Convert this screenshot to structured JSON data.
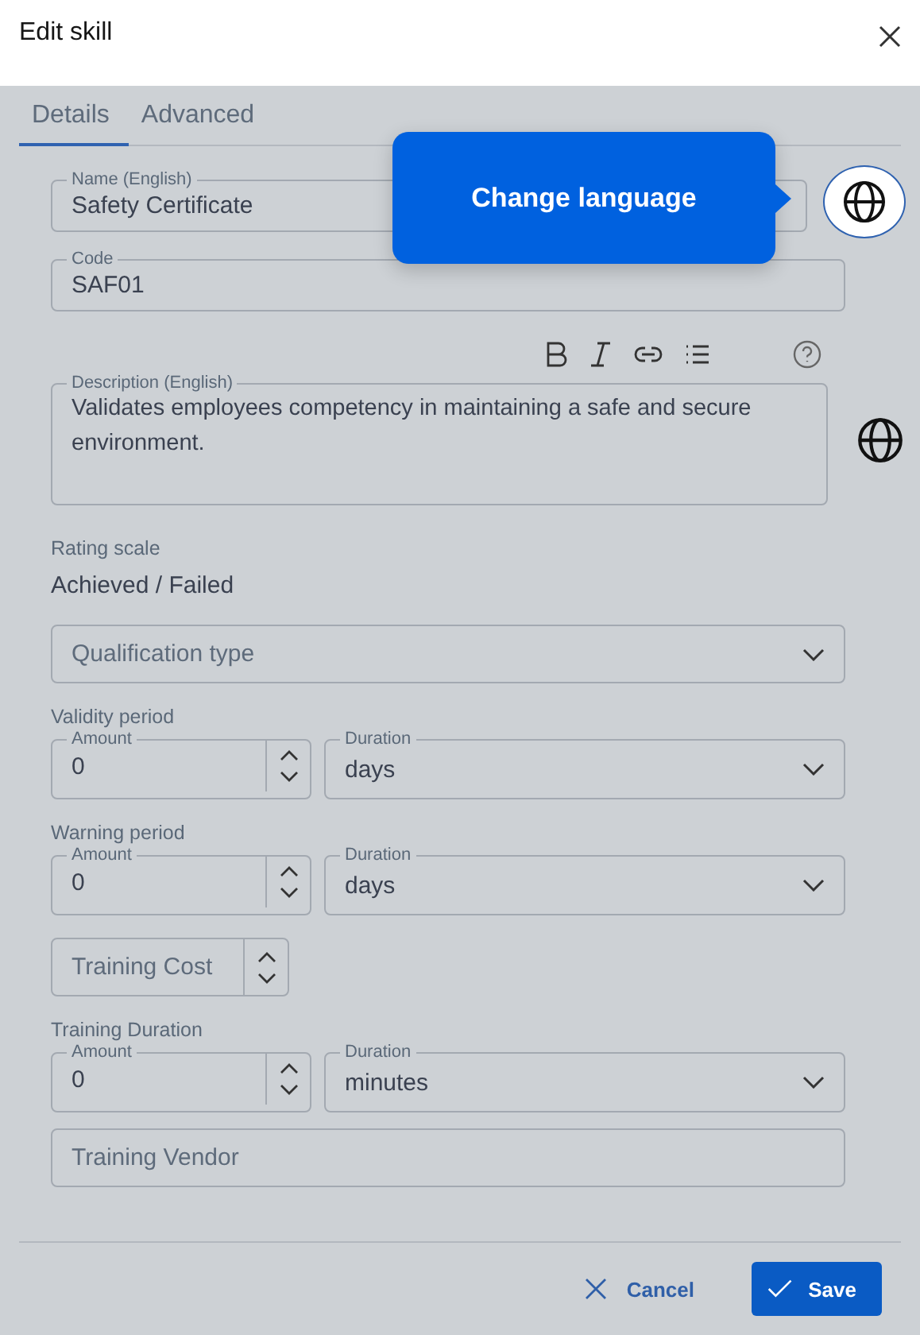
{
  "window": {
    "title": "Edit skill"
  },
  "tabs": [
    {
      "label": "Details",
      "selected": true
    },
    {
      "label": "Advanced",
      "selected": false
    }
  ],
  "name_field": {
    "label": "Name (English)",
    "value": "Safety Certificate"
  },
  "language_tooltip": {
    "text": "Change language"
  },
  "code_field": {
    "label": "Code",
    "value": "SAF01"
  },
  "description_field": {
    "label": "Description (English)",
    "value": "Validates employees competency in maintaining a safe and secure environment."
  },
  "rating_scale": {
    "label": "Rating scale",
    "value": "Achieved / Failed"
  },
  "qualification_type": {
    "placeholder": "Qualification type"
  },
  "fields": [
    {
      "kind": "period",
      "title": "Validity period",
      "amount": {
        "label": "Amount",
        "value": "0"
      },
      "duration": {
        "label": "Duration",
        "value": "days"
      }
    },
    {
      "kind": "period",
      "title": "Warning period",
      "amount": {
        "label": "Amount",
        "value": "0"
      },
      "duration": {
        "label": "Duration",
        "value": "days"
      }
    },
    {
      "kind": "number",
      "placeholder": "Training Cost"
    },
    {
      "kind": "period",
      "title": "Training Duration",
      "amount": {
        "label": "Amount",
        "value": "0"
      },
      "duration": {
        "label": "Duration",
        "value": "minutes"
      }
    },
    {
      "kind": "text",
      "placeholder": "Training Vendor"
    }
  ],
  "buttons": {
    "cancel": "Cancel",
    "save": "Save"
  }
}
